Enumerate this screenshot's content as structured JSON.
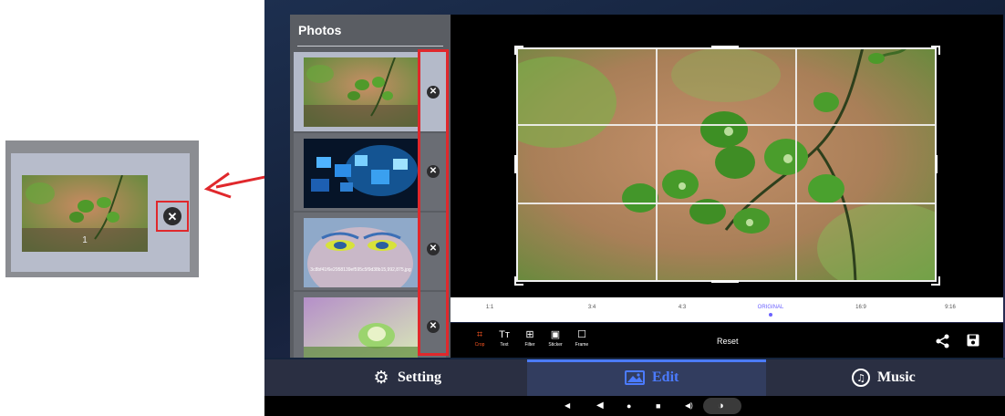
{
  "zoom_callout": {
    "thumb_number": "1",
    "close_glyph": "✕"
  },
  "photos_panel": {
    "title": "Photos",
    "items": [
      {
        "thumb": "green-leaves",
        "caption": "",
        "close_glyph": "✕"
      },
      {
        "thumb": "blue-cubes",
        "caption": "",
        "close_glyph": "✕"
      },
      {
        "thumb": "face-portrait",
        "caption": "3c8bf41f6e2958139ef595c5f9d38b15,992,875,jpg",
        "close_glyph": "✕"
      },
      {
        "thumb": "flower-sprout",
        "caption": "",
        "close_glyph": "✕"
      }
    ]
  },
  "editor": {
    "aspect_ratios": [
      "1:1",
      "3:4",
      "4:3",
      "ORIGINAL",
      "16:9",
      "9:16"
    ],
    "selected_ratio": "ORIGINAL",
    "tools": [
      {
        "label": "Crop",
        "icon": "crop-icon",
        "glyph": "⌗",
        "active": true
      },
      {
        "label": "Text",
        "icon": "text-icon",
        "glyph": "Tт",
        "active": false
      },
      {
        "label": "Filter",
        "icon": "filter-icon",
        "glyph": "⊞",
        "active": false
      },
      {
        "label": "Sticker",
        "icon": "sticker-icon",
        "glyph": "▣",
        "active": false
      },
      {
        "label": "Frame",
        "icon": "frame-icon",
        "glyph": "☐",
        "active": false
      }
    ],
    "reset_label": "Reset",
    "share_glyph": "<",
    "active_tool_color": "#ff5722"
  },
  "bottom_nav": {
    "setting_label": "Setting",
    "setting_glyph": "⚙",
    "edit_label": "Edit",
    "music_label": "Music",
    "music_glyph": "♫",
    "accent_color": "#4b7bff"
  },
  "system_bar": {
    "vol_down": "◀",
    "back": "◀",
    "home": "●",
    "recents": "■",
    "vol_up": "◀)",
    "screenshot": "◑"
  }
}
